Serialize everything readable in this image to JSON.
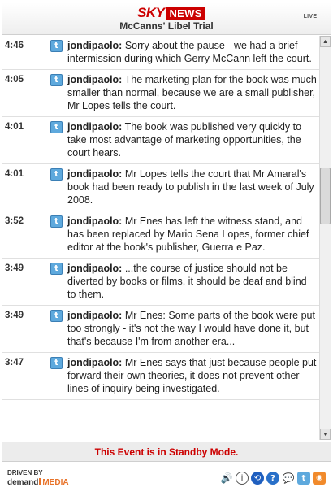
{
  "header": {
    "logo_sky": "SKY",
    "logo_news": "NEWS",
    "event_title": "McCanns' Libel Trial",
    "live_label": "LIVE!"
  },
  "entries": [
    {
      "time": "4:46",
      "author": "jondipaolo:",
      "text": " Sorry about the pause - we had a brief intermission during which Gerry McCann left the court."
    },
    {
      "time": "4:05",
      "author": "jondipaolo:",
      "text": " The marketing plan for the book was much smaller than normal, because we are a small publisher, Mr Lopes tells the court."
    },
    {
      "time": "4:01",
      "author": "jondipaolo:",
      "text": " The book was published very quickly to take most advantage of marketing opportunities, the court hears."
    },
    {
      "time": "4:01",
      "author": "jondipaolo:",
      "text": " Mr Lopes tells the court that Mr Amaral's book had been ready to publish in the last week of July 2008."
    },
    {
      "time": "3:52",
      "author": "jondipaolo:",
      "text": " Mr Enes has left the witness stand, and has been replaced by Mario Sena Lopes, former chief editor at the book's publisher, Guerra e Paz."
    },
    {
      "time": "3:49",
      "author": "jondipaolo:",
      "text": " ...the course of justice should not be diverted by books or films, it should be deaf and blind to them."
    },
    {
      "time": "3:49",
      "author": "jondipaolo:",
      "text": " Mr Enes: Some parts of the book were put too strongly - it's not the way I would have done it, but that's because I'm from another era..."
    },
    {
      "time": "3:47",
      "author": "jondipaolo:",
      "text": " Mr Enes says that just because people put forward their own theories, it does not prevent other lines of inquiry being investigated."
    }
  ],
  "status": {
    "message": "This Event is in Standby Mode."
  },
  "footer": {
    "driven_by": "DRIVEN BY",
    "demand": "demand",
    "media": "MEDIA",
    "icons": [
      "speaker-icon",
      "info-icon",
      "link-icon",
      "help-icon",
      "chat-icon",
      "twitter-icon",
      "rss-icon"
    ]
  },
  "icon_glyphs": {
    "twitter": "t",
    "scroll_up": "▲",
    "scroll_down": "▼",
    "speaker": "🔊",
    "info": "i",
    "link": "⟲",
    "help": "?",
    "chat": "💬",
    "rss": "◉"
  },
  "colors": {
    "brand_red": "#cc0000",
    "twitter_blue": "#5ea9dd",
    "media_orange": "#e8732a"
  }
}
